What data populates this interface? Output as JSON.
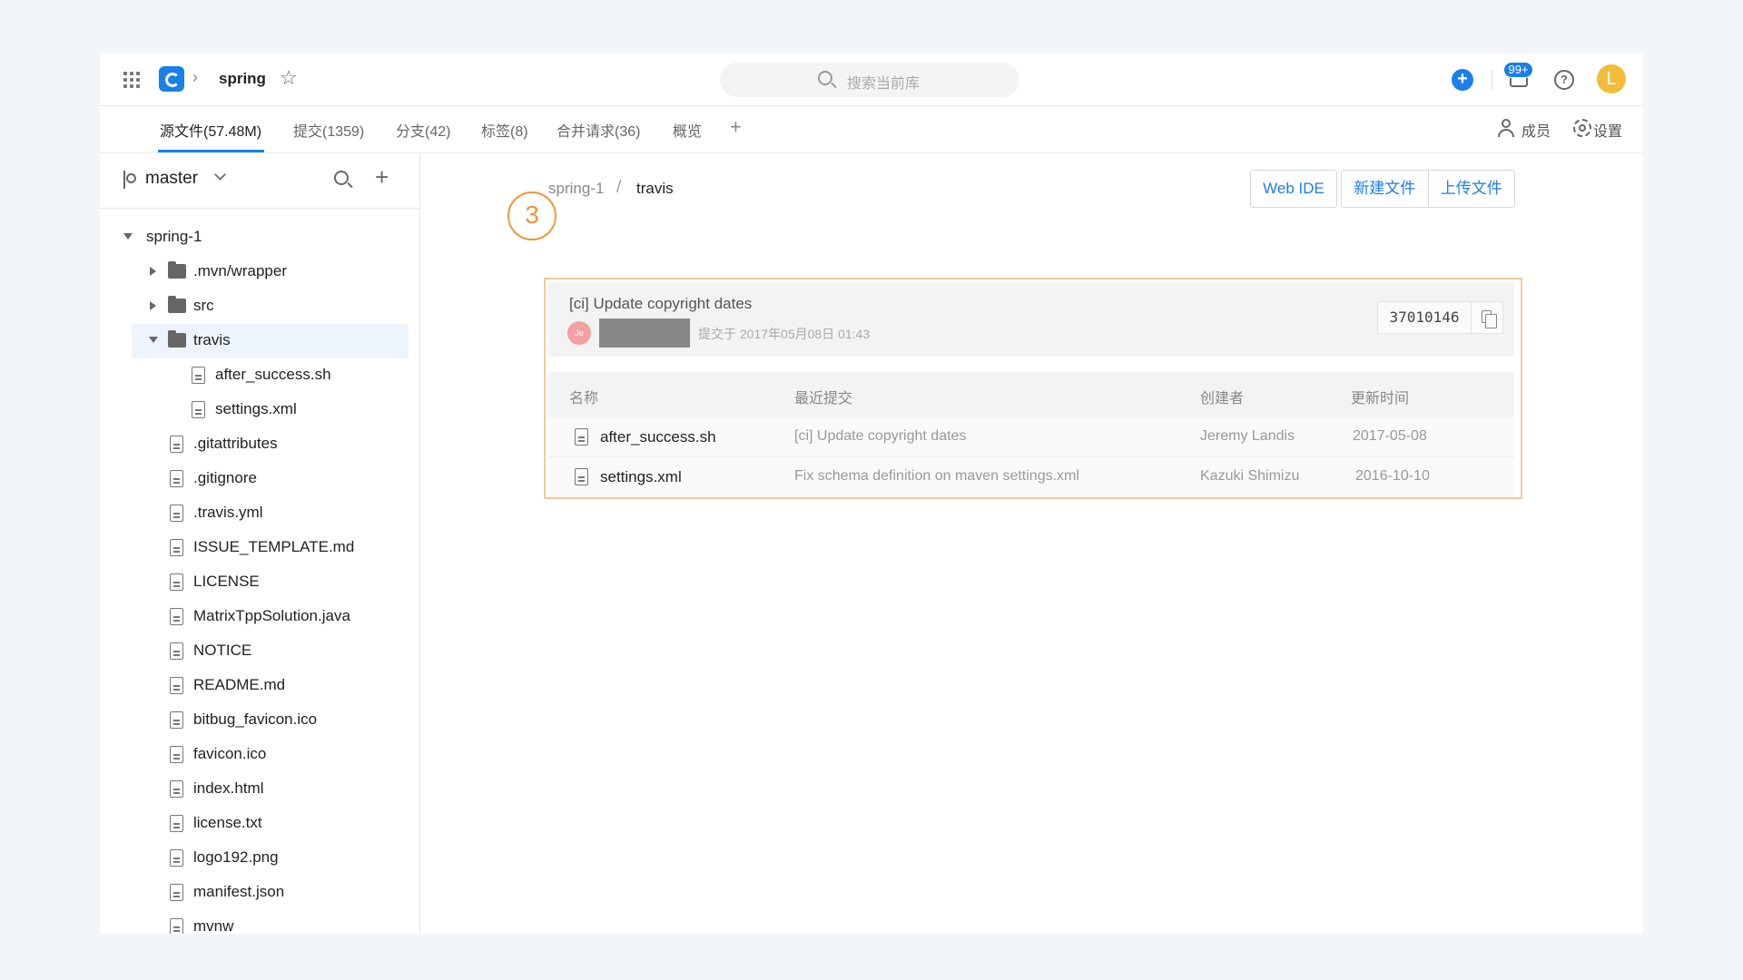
{
  "header": {
    "repo_name": "spring",
    "search_placeholder": "搜索当前库",
    "notification_badge": "99+",
    "help_symbol": "?",
    "avatar_letter": "L",
    "plus_symbol": "+"
  },
  "tabs": [
    {
      "label": "源文件(57.48M)",
      "active": true
    },
    {
      "label": "提交(1359)",
      "active": false
    },
    {
      "label": "分支(42)",
      "active": false
    },
    {
      "label": "标签(8)",
      "active": false
    },
    {
      "label": "合并请求(36)",
      "active": false
    },
    {
      "label": "概览",
      "active": false
    }
  ],
  "tab_plus": "+",
  "right_links": {
    "members": "成员",
    "settings": "设置"
  },
  "sidebar": {
    "branch": "master",
    "add_symbol": "+",
    "tree": [
      {
        "label": "spring-1",
        "type": "folder-root",
        "expanded": true,
        "depth": 0
      },
      {
        "label": ".mvn/wrapper",
        "type": "folder",
        "expanded": false,
        "depth": 1
      },
      {
        "label": "src",
        "type": "folder",
        "expanded": false,
        "depth": 1
      },
      {
        "label": "travis",
        "type": "folder",
        "expanded": true,
        "depth": 1,
        "selected": true
      },
      {
        "label": "after_success.sh",
        "type": "file",
        "depth": 2
      },
      {
        "label": "settings.xml",
        "type": "file",
        "depth": 2
      },
      {
        "label": ".gitattributes",
        "type": "file",
        "depth": 1
      },
      {
        "label": ".gitignore",
        "type": "file",
        "depth": 1
      },
      {
        "label": ".travis.yml",
        "type": "file",
        "depth": 1
      },
      {
        "label": "ISSUE_TEMPLATE.md",
        "type": "file",
        "depth": 1
      },
      {
        "label": "LICENSE",
        "type": "file",
        "depth": 1
      },
      {
        "label": "MatrixTppSolution.java",
        "type": "file",
        "depth": 1
      },
      {
        "label": "NOTICE",
        "type": "file",
        "depth": 1
      },
      {
        "label": "README.md",
        "type": "file",
        "depth": 1
      },
      {
        "label": "bitbug_favicon.ico",
        "type": "file",
        "depth": 1
      },
      {
        "label": "favicon.ico",
        "type": "file",
        "depth": 1
      },
      {
        "label": "index.html",
        "type": "file",
        "depth": 1
      },
      {
        "label": "license.txt",
        "type": "file",
        "depth": 1
      },
      {
        "label": "logo192.png",
        "type": "file",
        "depth": 1
      },
      {
        "label": "manifest.json",
        "type": "file",
        "depth": 1
      },
      {
        "label": "mvnw",
        "type": "file",
        "depth": 1
      }
    ]
  },
  "main": {
    "path_root": "spring-1",
    "path_sep": "/",
    "path_current": "travis",
    "web_ide_label": "Web IDE",
    "new_file_label": "新建文件",
    "upload_file_label": "上传文件",
    "step_number": "3",
    "commit": {
      "message": "[ci] Update copyright dates",
      "avatar_initials": "Je",
      "meta": "提交于 2017年05月08日 01:43",
      "hash": "37010146"
    },
    "table": {
      "headers": [
        "名称",
        "最近提交",
        "创建者",
        "更新时间"
      ],
      "rows": [
        {
          "name": "after_success.sh",
          "commit": "[ci] Update copyright dates",
          "author": "Jeremy Landis",
          "date": "2017-05-08"
        },
        {
          "name": "settings.xml",
          "commit": "Fix schema definition on maven settings.xml",
          "author": "Kazuki Shimizu",
          "date": "2016-10-10"
        }
      ]
    }
  },
  "colors": {
    "accent": "#1a7fe8",
    "step_highlight": "#f0953a",
    "avatar": "#f2bc3d"
  }
}
